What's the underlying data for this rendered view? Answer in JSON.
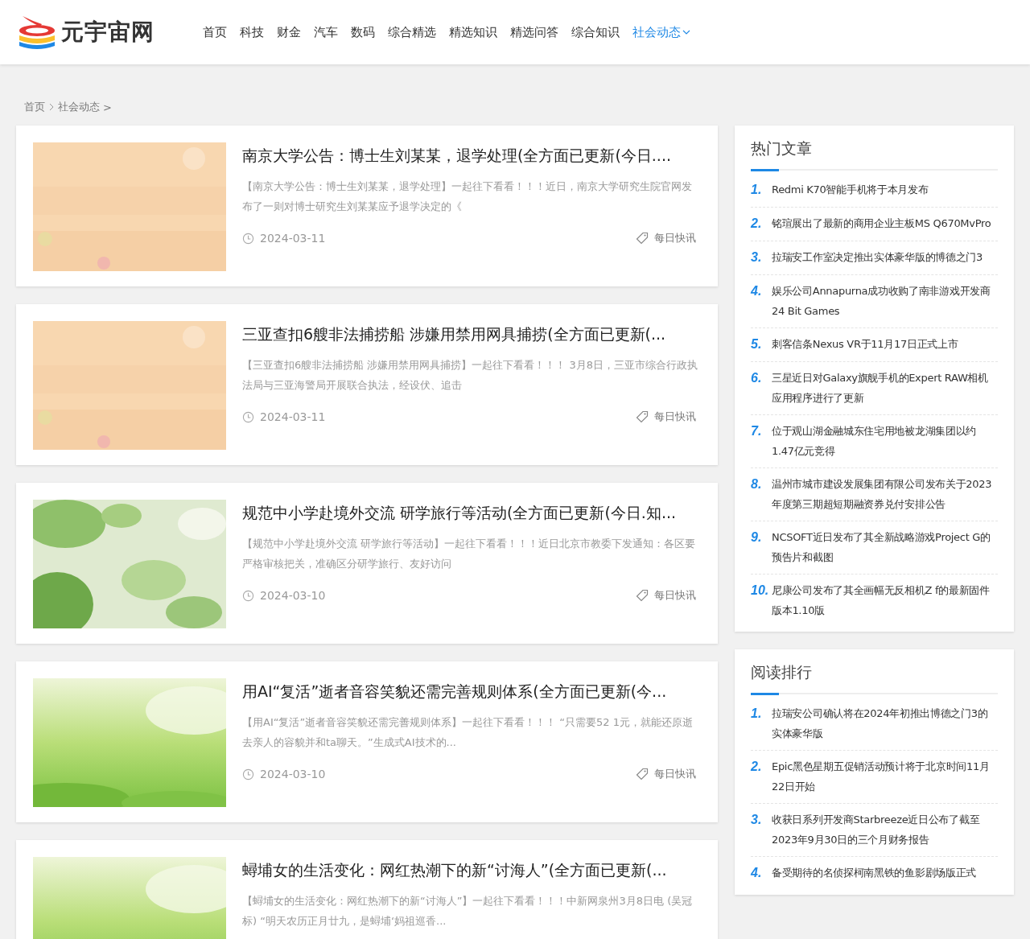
{
  "header": {
    "logo_text": "元宇宙网",
    "nav": [
      {
        "label": "首页",
        "selected": false
      },
      {
        "label": "科技",
        "selected": false
      },
      {
        "label": "财金",
        "selected": false
      },
      {
        "label": "汽车",
        "selected": false
      },
      {
        "label": "数码",
        "selected": false
      },
      {
        "label": "综合精选",
        "selected": false
      },
      {
        "label": "精选知识",
        "selected": false
      },
      {
        "label": "精选问答",
        "selected": false
      },
      {
        "label": "综合知识",
        "selected": false
      },
      {
        "label": "社会动态",
        "selected": true
      }
    ]
  },
  "breadcrumb": {
    "items": [
      "首页",
      "社会动态"
    ],
    "trail": ">"
  },
  "articles": [
    {
      "title": "南京大学公告：博士生刘某某，退学处理(全方面已更新(今日....",
      "summary": "【南京大学公告：博士生刘某某，退学处理】一起往下看看！！！近日，南京大学研究生院官网发布了一则对博士研究生刘某某应予退学决定的《",
      "date": "2024-03-11",
      "tag": "每日快讯"
    },
    {
      "title": "三亚查扣6艘非法捕捞船 涉嫌用禁用网具捕捞(全方面已更新(...",
      "summary": "【三亚查扣6艘非法捕捞船 涉嫌用禁用网具捕捞】一起往下看看！！！ 3月8日，三亚市综合行政执法局与三亚海警局开展联合执法，经设伏、追击",
      "date": "2024-03-11",
      "tag": "每日快讯"
    },
    {
      "title": "规范中小学赴境外交流 研学旅行等活动(全方面已更新(今日.知...",
      "summary": "【规范中小学赴境外交流 研学旅行等活动】一起往下看看！！！近日北京市教委下发通知：各区要严格审核把关，准确区分研学旅行、友好访问",
      "date": "2024-03-10",
      "tag": "每日快讯"
    },
    {
      "title": "用AI“复活”逝者音容笑貌还需完善规则体系(全方面已更新(今...",
      "summary": "【用AI“复活”逝者音容笑貌还需完善规则体系】一起往下看看！！！ “只需要52 1元，就能还原逝去亲人的容貌并和ta聊天。”生成式AI技术的...",
      "date": "2024-03-10",
      "tag": "每日快讯"
    },
    {
      "title": "蟳埔女的生活变化：网红热潮下的新“讨海人”(全方面已更新(...",
      "summary": "【蟳埔女的生活变化：网红热潮下的新“讨海人”】一起往下看看！！！中新网泉州3月8日电 (吴冠标) “明天农历正月廿九，是蟳埔‘妈祖巡香..."
    }
  ],
  "sidebar": [
    {
      "title": "热门文章",
      "items": [
        {
          "rank": "1.",
          "text": "Redmi K70智能手机将于本月发布"
        },
        {
          "rank": "2.",
          "text": "铭瑄展出了最新的商用企业主板MS Q670MvPro"
        },
        {
          "rank": "3.",
          "text": "拉瑞安工作室决定推出实体豪华版的博德之门3"
        },
        {
          "rank": "4.",
          "text": "娱乐公司Annapurna成功收购了南非游戏开发商24 Bit Games"
        },
        {
          "rank": "5.",
          "text": "刺客信条Nexus VR于11月17日正式上市"
        },
        {
          "rank": "6.",
          "text": "三星近日对Galaxy旗舰手机的Expert RAW相机应用程序进行了更新"
        },
        {
          "rank": "7.",
          "text": "位于观山湖金融城东住宅用地被龙湖集团以约1.47亿元竞得"
        },
        {
          "rank": "8.",
          "text": "温州市城市建设发展集团有限公司发布关于2023年度第三期超短期融资券兑付安排公告"
        },
        {
          "rank": "9.",
          "text": "NCSOFT近日发布了其全新战略游戏Project G的预告片和截图"
        },
        {
          "rank": "10.",
          "text": "尼康公司发布了其全画幅无反相机Z f的最新固件版本1.10版"
        }
      ]
    },
    {
      "title": "阅读排行",
      "items": [
        {
          "rank": "1.",
          "text": "拉瑞安公司确认将在2024年初推出博德之门3的实体豪华版"
        },
        {
          "rank": "2.",
          "text": "Epic黑色星期五促销活动预计将于北京时间11月22日开始"
        },
        {
          "rank": "3.",
          "text": "收获日系列开发商Starbreeze近日公布了截至2023年9月30日的三个月财务报告"
        },
        {
          "rank": "4.",
          "text": "备受期待的名侦探柯南黑铁的鱼影剧场版正式"
        }
      ]
    }
  ]
}
